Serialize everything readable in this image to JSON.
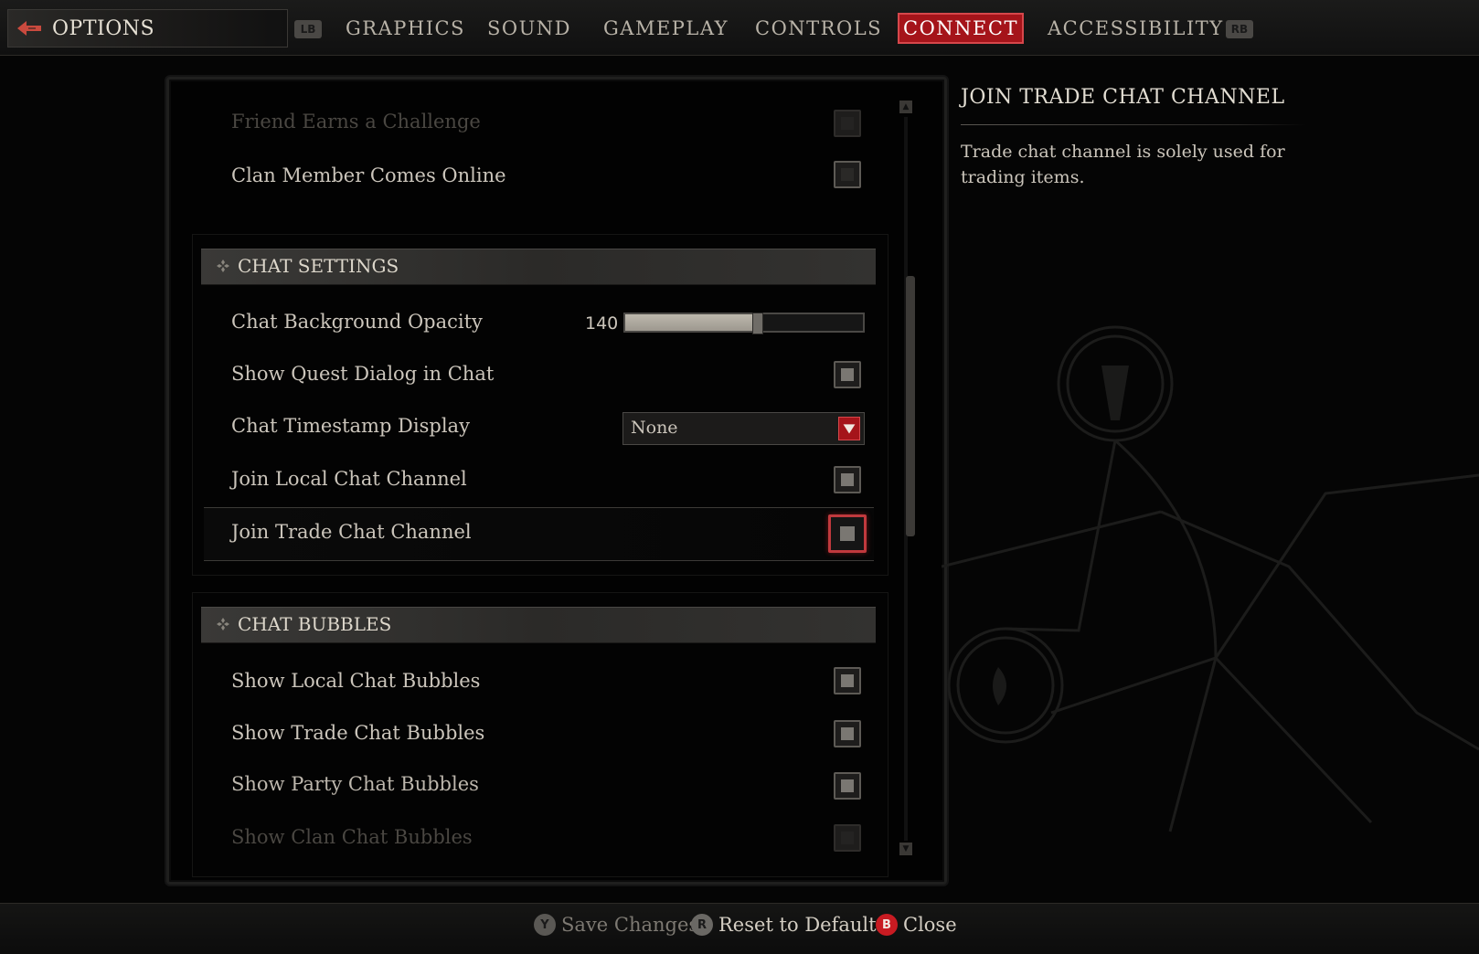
{
  "header": {
    "title": "OPTIONS",
    "left_bumper": "LB",
    "right_bumper": "RB",
    "tabs": [
      {
        "label": "GRAPHICS"
      },
      {
        "label": "SOUND"
      },
      {
        "label": "GAMEPLAY"
      },
      {
        "label": "CONTROLS"
      },
      {
        "label": "CONNECT",
        "active": true
      },
      {
        "label": "ACCESSIBILITY"
      }
    ],
    "active_color": "#a5141a"
  },
  "settings": {
    "notifications": {
      "friend_earns_challenge": {
        "label": "Friend Earns a Challenge",
        "checked": false
      },
      "clan_member_online": {
        "label": "Clan Member Comes Online",
        "checked": false
      }
    },
    "chat_settings": {
      "title": "CHAT SETTINGS",
      "background_opacity": {
        "label": "Chat Background Opacity",
        "value": "140",
        "fraction": 0.55
      },
      "show_quest_dialog": {
        "label": "Show Quest Dialog in Chat",
        "checked": true
      },
      "timestamp_display": {
        "label": "Chat Timestamp Display",
        "value": "None"
      },
      "join_local": {
        "label": "Join Local Chat Channel",
        "checked": true
      },
      "join_trade": {
        "label": "Join Trade Chat Channel",
        "checked": true
      }
    },
    "chat_bubbles": {
      "title": "CHAT BUBBLES",
      "show_local": {
        "label": "Show Local Chat Bubbles",
        "checked": true
      },
      "show_trade": {
        "label": "Show Trade Chat Bubbles",
        "checked": true
      },
      "show_party": {
        "label": "Show Party Chat Bubbles",
        "checked": true
      },
      "show_clan": {
        "label": "Show Clan Chat Bubbles",
        "checked": true
      }
    },
    "scroll": {
      "thumb_start": 0.22,
      "thumb_length": 0.36
    }
  },
  "info": {
    "title": "JOIN TRADE CHAT CHANNEL",
    "description": "Trade chat channel is solely used for trading items."
  },
  "footer": {
    "save": {
      "glyph": "Y",
      "label": "Save Changes"
    },
    "reset": {
      "glyph": "R",
      "label": "Reset to Defaults"
    },
    "close": {
      "glyph": "B",
      "label": "Close"
    }
  }
}
